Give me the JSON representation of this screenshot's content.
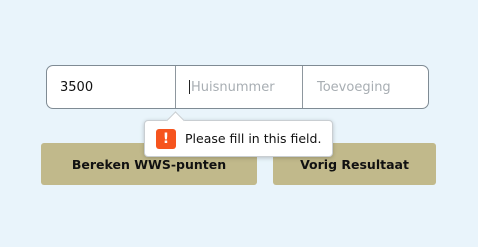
{
  "address_form": {
    "postcode_value": "3500",
    "huisnummer_placeholder": "Huisnummer",
    "toevoeging_placeholder": "Toevoeging"
  },
  "buttons": {
    "calculate_label": "Bereken WWS-punten",
    "previous_label": "Vorig Resultaat"
  },
  "validation_tooltip": {
    "icon": "warning-icon",
    "icon_glyph": "!",
    "message": "Please fill in this field.",
    "icon_color": "#f6541e"
  },
  "colors": {
    "background": "#e9f4fb",
    "button": "#c1b98b"
  }
}
